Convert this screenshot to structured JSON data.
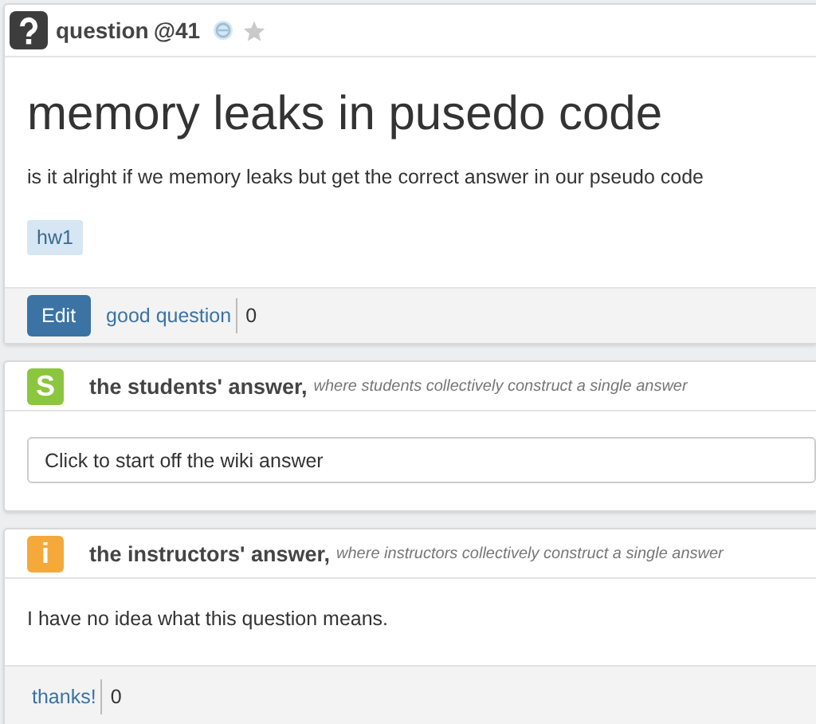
{
  "question": {
    "label": "question",
    "number": "@41",
    "title": "memory leaks in pusedo code",
    "body": "is it alright if we memory leaks but get the correct answer  in our pseudo code",
    "tags": [
      "hw1"
    ],
    "edit_button": "Edit",
    "good_question": "good question",
    "good_count": "0"
  },
  "student_answer": {
    "badge": "S",
    "title": "the students' answer,",
    "subtitle": "where students collectively construct a single answer",
    "placeholder": "Click to start off the wiki answer"
  },
  "instructor_answer": {
    "badge": "i",
    "title": "the instructors' answer,",
    "subtitle": "where instructors collectively construct a single answer",
    "body": "I have no idea what this question means.",
    "thanks": "thanks!",
    "thanks_count": "0"
  }
}
